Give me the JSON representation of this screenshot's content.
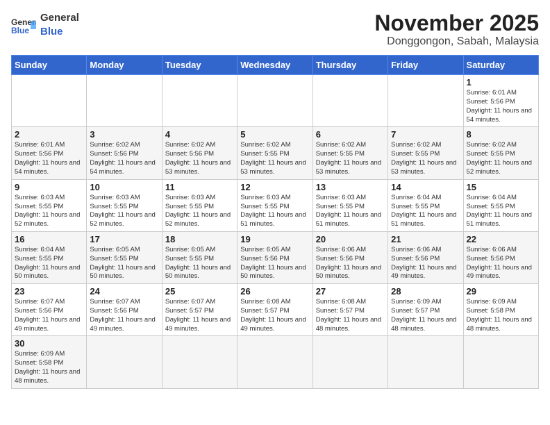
{
  "header": {
    "logo_text_general": "General",
    "logo_text_blue": "Blue",
    "month_title": "November 2025",
    "location": "Donggongon, Sabah, Malaysia"
  },
  "weekdays": [
    "Sunday",
    "Monday",
    "Tuesday",
    "Wednesday",
    "Thursday",
    "Friday",
    "Saturday"
  ],
  "weeks": [
    [
      {
        "day": "",
        "info": ""
      },
      {
        "day": "",
        "info": ""
      },
      {
        "day": "",
        "info": ""
      },
      {
        "day": "",
        "info": ""
      },
      {
        "day": "",
        "info": ""
      },
      {
        "day": "",
        "info": ""
      },
      {
        "day": "1",
        "info": "Sunrise: 6:01 AM\nSunset: 5:56 PM\nDaylight: 11 hours and 54 minutes."
      }
    ],
    [
      {
        "day": "2",
        "info": "Sunrise: 6:01 AM\nSunset: 5:56 PM\nDaylight: 11 hours and 54 minutes."
      },
      {
        "day": "3",
        "info": "Sunrise: 6:02 AM\nSunset: 5:56 PM\nDaylight: 11 hours and 54 minutes."
      },
      {
        "day": "4",
        "info": "Sunrise: 6:02 AM\nSunset: 5:56 PM\nDaylight: 11 hours and 53 minutes."
      },
      {
        "day": "5",
        "info": "Sunrise: 6:02 AM\nSunset: 5:55 PM\nDaylight: 11 hours and 53 minutes."
      },
      {
        "day": "6",
        "info": "Sunrise: 6:02 AM\nSunset: 5:55 PM\nDaylight: 11 hours and 53 minutes."
      },
      {
        "day": "7",
        "info": "Sunrise: 6:02 AM\nSunset: 5:55 PM\nDaylight: 11 hours and 53 minutes."
      },
      {
        "day": "8",
        "info": "Sunrise: 6:02 AM\nSunset: 5:55 PM\nDaylight: 11 hours and 52 minutes."
      }
    ],
    [
      {
        "day": "9",
        "info": "Sunrise: 6:03 AM\nSunset: 5:55 PM\nDaylight: 11 hours and 52 minutes."
      },
      {
        "day": "10",
        "info": "Sunrise: 6:03 AM\nSunset: 5:55 PM\nDaylight: 11 hours and 52 minutes."
      },
      {
        "day": "11",
        "info": "Sunrise: 6:03 AM\nSunset: 5:55 PM\nDaylight: 11 hours and 52 minutes."
      },
      {
        "day": "12",
        "info": "Sunrise: 6:03 AM\nSunset: 5:55 PM\nDaylight: 11 hours and 51 minutes."
      },
      {
        "day": "13",
        "info": "Sunrise: 6:03 AM\nSunset: 5:55 PM\nDaylight: 11 hours and 51 minutes."
      },
      {
        "day": "14",
        "info": "Sunrise: 6:04 AM\nSunset: 5:55 PM\nDaylight: 11 hours and 51 minutes."
      },
      {
        "day": "15",
        "info": "Sunrise: 6:04 AM\nSunset: 5:55 PM\nDaylight: 11 hours and 51 minutes."
      }
    ],
    [
      {
        "day": "16",
        "info": "Sunrise: 6:04 AM\nSunset: 5:55 PM\nDaylight: 11 hours and 50 minutes."
      },
      {
        "day": "17",
        "info": "Sunrise: 6:05 AM\nSunset: 5:55 PM\nDaylight: 11 hours and 50 minutes."
      },
      {
        "day": "18",
        "info": "Sunrise: 6:05 AM\nSunset: 5:55 PM\nDaylight: 11 hours and 50 minutes."
      },
      {
        "day": "19",
        "info": "Sunrise: 6:05 AM\nSunset: 5:56 PM\nDaylight: 11 hours and 50 minutes."
      },
      {
        "day": "20",
        "info": "Sunrise: 6:06 AM\nSunset: 5:56 PM\nDaylight: 11 hours and 50 minutes."
      },
      {
        "day": "21",
        "info": "Sunrise: 6:06 AM\nSunset: 5:56 PM\nDaylight: 11 hours and 49 minutes."
      },
      {
        "day": "22",
        "info": "Sunrise: 6:06 AM\nSunset: 5:56 PM\nDaylight: 11 hours and 49 minutes."
      }
    ],
    [
      {
        "day": "23",
        "info": "Sunrise: 6:07 AM\nSunset: 5:56 PM\nDaylight: 11 hours and 49 minutes."
      },
      {
        "day": "24",
        "info": "Sunrise: 6:07 AM\nSunset: 5:56 PM\nDaylight: 11 hours and 49 minutes."
      },
      {
        "day": "25",
        "info": "Sunrise: 6:07 AM\nSunset: 5:57 PM\nDaylight: 11 hours and 49 minutes."
      },
      {
        "day": "26",
        "info": "Sunrise: 6:08 AM\nSunset: 5:57 PM\nDaylight: 11 hours and 49 minutes."
      },
      {
        "day": "27",
        "info": "Sunrise: 6:08 AM\nSunset: 5:57 PM\nDaylight: 11 hours and 48 minutes."
      },
      {
        "day": "28",
        "info": "Sunrise: 6:09 AM\nSunset: 5:57 PM\nDaylight: 11 hours and 48 minutes."
      },
      {
        "day": "29",
        "info": "Sunrise: 6:09 AM\nSunset: 5:58 PM\nDaylight: 11 hours and 48 minutes."
      }
    ],
    [
      {
        "day": "30",
        "info": "Sunrise: 6:09 AM\nSunset: 5:58 PM\nDaylight: 11 hours and 48 minutes."
      },
      {
        "day": "",
        "info": ""
      },
      {
        "day": "",
        "info": ""
      },
      {
        "day": "",
        "info": ""
      },
      {
        "day": "",
        "info": ""
      },
      {
        "day": "",
        "info": ""
      },
      {
        "day": "",
        "info": ""
      }
    ]
  ]
}
